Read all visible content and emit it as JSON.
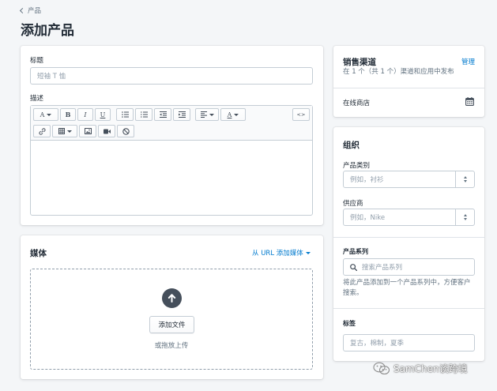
{
  "breadcrumb": {
    "back_label": "产品"
  },
  "page": {
    "title": "添加产品"
  },
  "product_card": {
    "title_label": "标题",
    "title_placeholder": "短袖 T 恤",
    "description_label": "描述",
    "toolbar": {
      "font_button": "A",
      "bold_button": "B",
      "italic_button": "I",
      "underline_button": "U",
      "text_color_button": "A",
      "source_button": "<>"
    }
  },
  "media_card": {
    "title": "媒体",
    "add_from_url_label": "从 URL 添加媒体",
    "add_file_button": "添加文件",
    "drop_hint": "或拖放上传"
  },
  "sales_channels": {
    "title": "销售渠道",
    "manage_link": "管理",
    "summary": "在 1 个（共 1 个）渠道和应用中发布",
    "channel_name": "在线商店"
  },
  "organization": {
    "title": "组织",
    "product_type_label": "产品类别",
    "product_type_placeholder": "例如，衬衫",
    "vendor_label": "供应商",
    "vendor_placeholder": "例如，Nike",
    "collections_label": "产品系列",
    "collections_placeholder": "搜索产品系列",
    "collections_hint": "将此产品添加到一个产品系列中，方便客户搜索。",
    "tags_label": "标签",
    "tags_placeholder": "复古，棉制，夏季"
  },
  "watermark": {
    "text": "SamChen谈跨境"
  },
  "colors": {
    "background": "#f4f6f8",
    "link": "#007ace",
    "text": "#212b36",
    "border": "#c4cdd5"
  }
}
